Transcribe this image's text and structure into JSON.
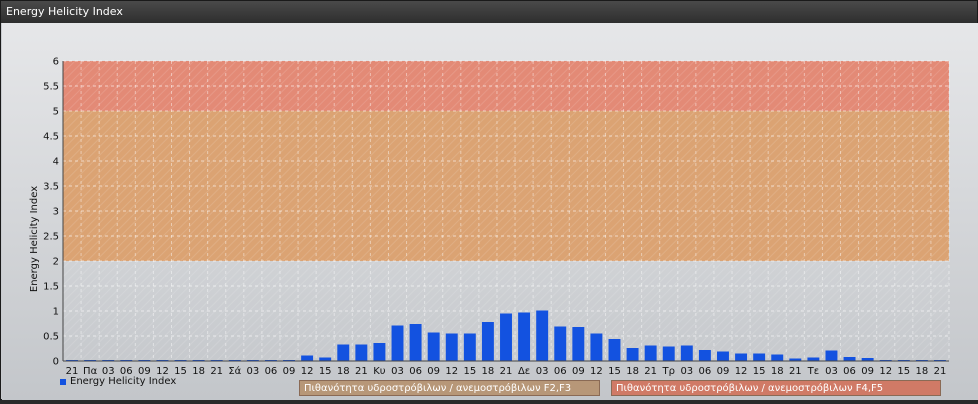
{
  "window": {
    "title": "Energy Helicity Index"
  },
  "colors": {
    "bar": "#1352e0",
    "band_low": "#dba373",
    "band_high": "#e38a76",
    "band_low_box": "#b79778",
    "band_high_box": "#d07a66"
  },
  "chart_data": {
    "type": "bar",
    "ylabel": "Energy Helicity Index",
    "ylim": [
      0,
      6
    ],
    "yticks": [
      "0",
      "0.5",
      "1",
      "1.5",
      "2",
      "2.5",
      "3",
      "3.5",
      "4",
      "4.5",
      "5",
      "5.5",
      "6"
    ],
    "grid": true,
    "categories": [
      "21",
      "Πα",
      "03",
      "06",
      "09",
      "12",
      "15",
      "18",
      "21",
      "Σά",
      "03",
      "06",
      "09",
      "12",
      "15",
      "18",
      "21",
      "Κυ",
      "03",
      "06",
      "09",
      "12",
      "15",
      "18",
      "21",
      "Δε",
      "03",
      "06",
      "09",
      "12",
      "15",
      "18",
      "21",
      "Τρ",
      "03",
      "06",
      "09",
      "12",
      "15",
      "18",
      "21",
      "Τε",
      "03",
      "06",
      "09",
      "12",
      "15",
      "18",
      "21"
    ],
    "series": [
      {
        "name": "Energy Helicity Index",
        "values": [
          0.01,
          0.01,
          0.01,
          0.01,
          0.01,
          0.01,
          0.01,
          0.01,
          0.01,
          0.01,
          0.01,
          0.01,
          0.01,
          0.11,
          0.07,
          0.33,
          0.33,
          0.36,
          0.71,
          0.74,
          0.57,
          0.55,
          0.55,
          0.78,
          0.95,
          0.97,
          1.01,
          0.69,
          0.68,
          0.55,
          0.44,
          0.26,
          0.31,
          0.29,
          0.31,
          0.22,
          0.19,
          0.15,
          0.15,
          0.13,
          0.05,
          0.07,
          0.21,
          0.08,
          0.06,
          0.01,
          0.01,
          0.01,
          0.01
        ]
      }
    ],
    "bands": [
      {
        "label": "Πιθανότητα υδροστρόβιλων / ανεμοστρόβιλων F2,F3",
        "from": 2,
        "to": 5
      },
      {
        "label": "Πιθανότητα υδροστρόβιλων / ανεμοστρόβιλων F4,F5",
        "from": 5,
        "to": 6
      }
    ],
    "legend": "bottom-left"
  }
}
